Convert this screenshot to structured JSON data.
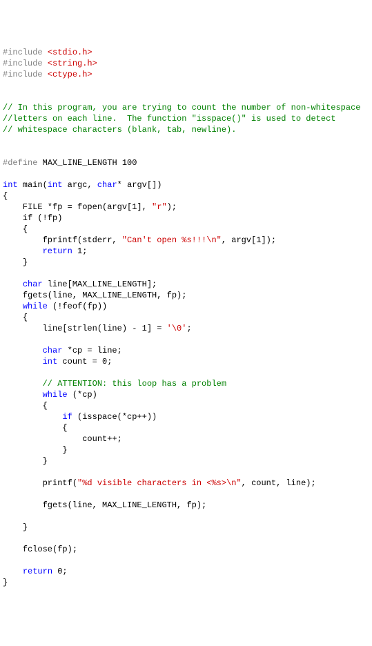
{
  "l1p": "#include ",
  "l1s": "<stdio.h>",
  "l2p": "#include ",
  "l2s": "<string.h>",
  "l3p": "#include ",
  "l3s": "<ctype.h>",
  "c1": "// In this program, you are trying to count the number of non-whitespace",
  "c2": "//letters on each line.  The function \"isspace()\" is used to detect",
  "c3": "// whitespace characters (blank, tab, newline).",
  "def1": "#define",
  "def2": " MAX_LINE_LENGTH 100",
  "kw_int": "int",
  "m_main": " main(",
  "m_argc": " argc, ",
  "kw_char": "char",
  "m_argv": "* argv[])",
  "brace_o": "{",
  "brace_c": "}",
  "file_decl": "    FILE *fp = fopen(argv[1], ",
  "str_r": "\"r\"",
  "file_end": ");",
  "if_fp": "    if (!fp)",
  "fprintf1": "        fprintf(stderr, ",
  "str_cant": "\"Can't open %s!!!\\n\"",
  "fprintf2": ", argv[1]);",
  "kw_return": "return",
  "ret1": " 1;",
  "chardecl": " line[MAX_LINE_LENGTH];",
  "fgets1": "    fgets(line, MAX_LINE_LENGTH, fp);",
  "kw_while": "while",
  "while_feof": " (!feof(fp))",
  "line_strlen": "        line[strlen(line) - 1] = ",
  "str_nul": "'\\0'",
  "semi": ";",
  "cp_decl": " *cp = line;",
  "count_decl": " count = 0;",
  "attn": "// ATTENTION: this loop has a problem",
  "while_cp": " (*cp)",
  "kw_if": "if",
  "if_isspace": " (isspace(*cp++))",
  "count_inc": "                count++;",
  "printf1": "        printf(",
  "str_vis": "\"%d visible characters in <%s>\\n\"",
  "printf2": ", count, line);",
  "fgets2": "        fgets(line, MAX_LINE_LENGTH, fp);",
  "fclose": "    fclose(fp);",
  "ret0": " 0;"
}
